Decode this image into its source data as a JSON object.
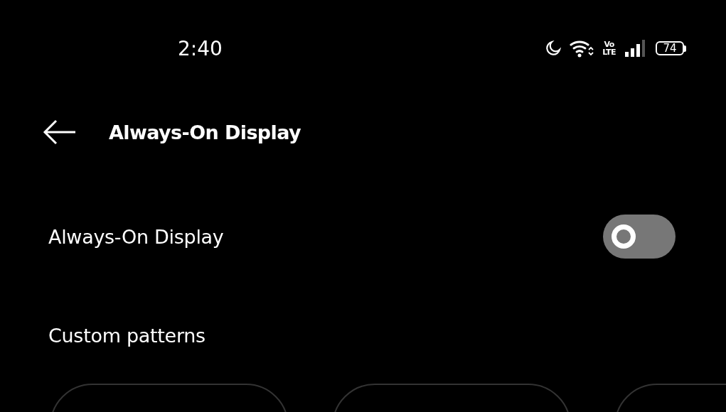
{
  "status_bar": {
    "time": "2:40",
    "volte": [
      "Vo",
      "LTE"
    ],
    "battery": "74"
  },
  "header": {
    "title": "Always-On Display"
  },
  "settings": [
    {
      "kind": "switch",
      "label": "Always-On Display",
      "on": false
    }
  ],
  "section": {
    "title": "Custom patterns"
  },
  "patterns": [
    {
      "kind": "card"
    },
    {
      "kind": "card"
    },
    {
      "kind": "card"
    }
  ]
}
